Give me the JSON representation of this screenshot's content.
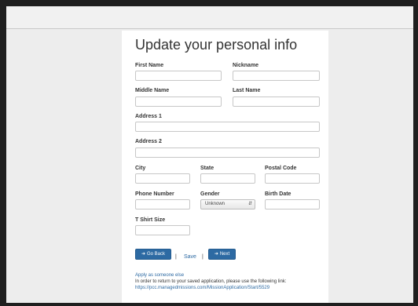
{
  "form": {
    "title": "Update your personal info",
    "labels": {
      "first_name": "First Name",
      "nickname": "Nickname",
      "middle_name": "Middle Name",
      "last_name": "Last Name",
      "address1": "Address 1",
      "address2": "Address 2",
      "city": "City",
      "state": "State",
      "postal_code": "Postal Code",
      "phone": "Phone Number",
      "gender": "Gender",
      "birth_date": "Birth Date",
      "tshirt": "T Shirt Size"
    },
    "values": {
      "first_name": "",
      "nickname": "",
      "middle_name": "",
      "last_name": "",
      "address1": "",
      "address2": "",
      "city": "",
      "state": "",
      "postal_code": "",
      "phone": "",
      "birth_date": "",
      "tshirt": ""
    },
    "gender_selected": "Unknown"
  },
  "actions": {
    "go_back": "Go Back",
    "separator": "|",
    "save": "Save",
    "next": "Next"
  },
  "footer": {
    "apply_as_other": "Apply as someone else",
    "return_text": "In order to return to your saved application, please use the following link:",
    "return_url": "https://pcc.managedmissions.com/MissionApplication/Start/5529"
  },
  "colors": {
    "accent": "#2d6aa3",
    "frame": "#1f1f1f",
    "page_bg": "#ededed"
  },
  "icons": {
    "back": "arrow-left-icon",
    "next": "arrow-right-icon",
    "dropdown": "select-arrows-icon"
  }
}
